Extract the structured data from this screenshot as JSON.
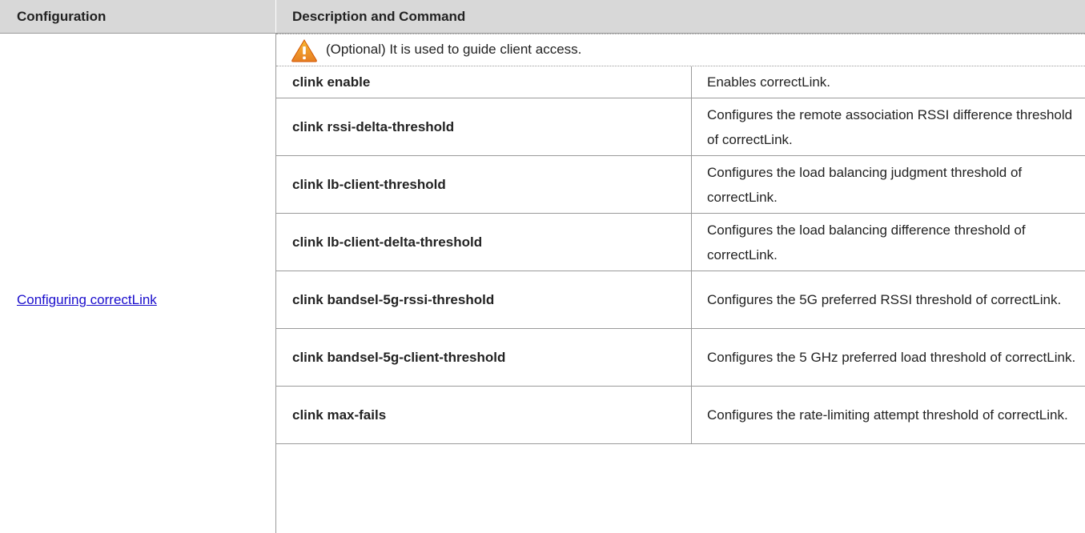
{
  "header": {
    "configuration": "Configuration",
    "description_and_command": "Description and Command"
  },
  "config_link": "Configuring correctLink",
  "note": {
    "icon": "warning-icon",
    "text": "(Optional) It is used to guide client access."
  },
  "rows": [
    {
      "command": "clink enable",
      "description": "Enables correctLink."
    },
    {
      "command": "clink rssi-delta-threshold",
      "description": "Configures the remote association RSSI difference threshold of correctLink."
    },
    {
      "command": "clink lb-client-threshold",
      "description": "Configures the load balancing judgment threshold of correctLink."
    },
    {
      "command": "clink lb-client-delta-threshold",
      "description": "Configures the load balancing difference threshold of correctLink."
    },
    {
      "command": "clink bandsel-5g-rssi-threshold",
      "description": "Configures the 5G preferred RSSI threshold of correctLink."
    },
    {
      "command": "clink bandsel-5g-client-threshold",
      "description": "Configures the 5 GHz preferred load threshold of correctLink."
    },
    {
      "command": "clink max-fails",
      "description": "Configures the rate-limiting attempt threshold of correctLink."
    }
  ],
  "colors": {
    "header_bg": "#d8d8d8",
    "link": "#1a0dcc",
    "warning_fill": "#f39c12"
  }
}
